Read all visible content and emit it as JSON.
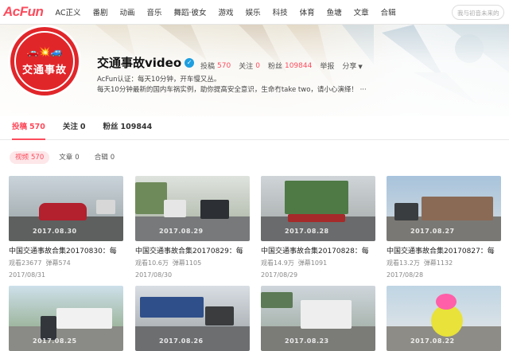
{
  "nav": {
    "logo": "AcFun",
    "items": [
      "AC正义",
      "番剧",
      "动画",
      "音乐",
      "舞蹈·彼女",
      "游戏",
      "娱乐",
      "科技",
      "体育",
      "鱼塘",
      "文章",
      "合辑"
    ],
    "search_placeholder": "我与初音未来的"
  },
  "profile": {
    "avatar_text": "交通事故",
    "name": "交通事故video",
    "stats": {
      "posts_label": "投稿",
      "posts": "570",
      "follow_label": "关注",
      "follow": "0",
      "fans_label": "粉丝",
      "fans": "109844",
      "report_label": "举报",
      "share_label": "分享"
    },
    "cert": "AcFun认证：每天10分钟，开车慢又丛。",
    "desc": "每天10分钟最新的国内车祸实例，助你提高安全意识，生命冇take  two，请小心演绎！ ···"
  },
  "tabs": [
    {
      "label": "投稿",
      "count": "570",
      "active": true
    },
    {
      "label": "关注",
      "count": "0",
      "active": false
    },
    {
      "label": "粉丝",
      "count": "109844",
      "active": false
    }
  ],
  "subtabs": [
    {
      "label": "视频",
      "count": "570",
      "active": true
    },
    {
      "label": "文章",
      "count": "0",
      "active": false
    },
    {
      "label": "合辑",
      "count": "0",
      "active": false
    }
  ],
  "videos": [
    {
      "title": "中国交通事故合集20170830：每",
      "views_label": "观看",
      "views": "23677",
      "danmu_label": "弹幕",
      "danmu": "574",
      "date": "2017/08/31",
      "stamp": "2017.08.30"
    },
    {
      "title": "中国交通事故合集20170829：每",
      "views_label": "观看",
      "views": "10.6万",
      "danmu_label": "弹幕",
      "danmu": "1105",
      "date": "2017/08/30",
      "stamp": "2017.08.29"
    },
    {
      "title": "中国交通事故合集20170828：每",
      "views_label": "观看",
      "views": "14.9万",
      "danmu_label": "弹幕",
      "danmu": "1091",
      "date": "2017/08/29",
      "stamp": "2017.08.28"
    },
    {
      "title": "中国交通事故合集20170827：每",
      "views_label": "观看",
      "views": "13.2万",
      "danmu_label": "弹幕",
      "danmu": "1132",
      "date": "2017/08/28",
      "stamp": "2017.08.27"
    },
    {
      "title": "",
      "stamp": "2017.08.25"
    },
    {
      "title": "",
      "stamp": "2017.08.26"
    },
    {
      "title": "",
      "stamp": "2017.08.23"
    },
    {
      "title": "",
      "stamp": "2017.08.22"
    }
  ],
  "colors": {
    "accent": "#fd4c5d",
    "verify": "#1e9fe0"
  }
}
